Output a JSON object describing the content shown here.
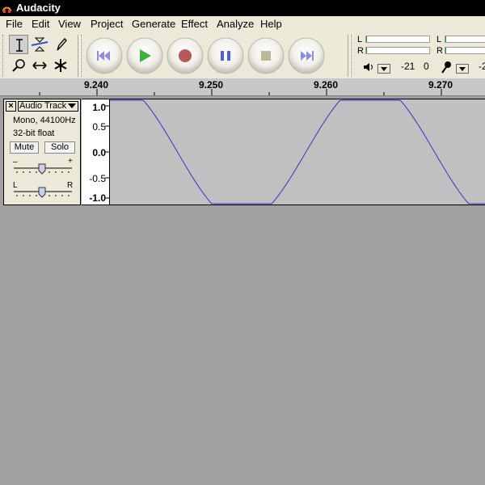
{
  "window": {
    "title": "Audacity"
  },
  "menu": [
    "File",
    "Edit",
    "View",
    "Project",
    "Generate",
    "Effect",
    "Analyze",
    "Help"
  ],
  "tools": {
    "selection": "selection-tool",
    "envelope": "envelope-tool",
    "draw": "draw-tool",
    "zoom": "zoom-tool",
    "timeshift": "time-shift-tool",
    "multi": "multi-tool",
    "active": "selection"
  },
  "transport": [
    "skip-to-start",
    "play",
    "record",
    "pause",
    "stop",
    "skip-to-end"
  ],
  "meters": {
    "playback": {
      "left_label": "L",
      "right_label": "R",
      "scale": [
        "-21",
        "0"
      ]
    },
    "record": {
      "left_label": "L",
      "right_label": "R",
      "scale": [
        "-2"
      ]
    }
  },
  "ruler": {
    "labels": [
      "9.240",
      "9.250",
      "9.260",
      "9.270"
    ]
  },
  "track": {
    "name": "Audio Track",
    "format": "Mono, 44100Hz",
    "bitdepth": "32-bit float",
    "mute_label": "Mute",
    "solo_label": "Solo",
    "gain_minus": "–",
    "gain_plus": "+",
    "pan_left": "L",
    "pan_right": "R",
    "amplitude_scale": [
      "1.0",
      "0.5",
      "0.0",
      "-0.5",
      "-1.0"
    ],
    "waveform_color": "#3333cc"
  }
}
